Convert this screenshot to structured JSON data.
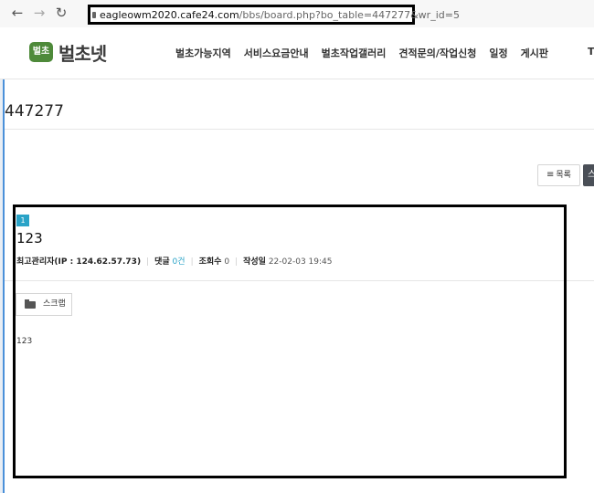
{
  "browser": {
    "back": "←",
    "forward": "→",
    "reload": "↻",
    "url_host": "eagleowm2020.cafe24.com",
    "url_path": "/bbs/board.php?bo_table=447277&wr_id=5"
  },
  "site": {
    "logo_badge": "벌초",
    "logo_text": "벌초넷",
    "menu": [
      "벌초가능지역",
      "서비스요금안내",
      "벌초작업갤러리",
      "견적문의/작업신청",
      "일정",
      "게시판"
    ],
    "menu_extra": "T"
  },
  "board": {
    "title": "447277",
    "list_button": "목록",
    "list_icon": "list-icon",
    "write_button": "스"
  },
  "post": {
    "category": "1",
    "title": "123",
    "author": "최고관리자(IP : 124.62.57.73)",
    "comments_label": "댓글",
    "comments_value": "0건",
    "views_label": "조회수",
    "views_value": "0",
    "date_label": "작성일",
    "date_value": "22-02-03 19:45",
    "scrap_button": "스크랩",
    "body": "123"
  },
  "colors": {
    "accent": "#2aa3c7",
    "logo": "#4e8a3a"
  }
}
